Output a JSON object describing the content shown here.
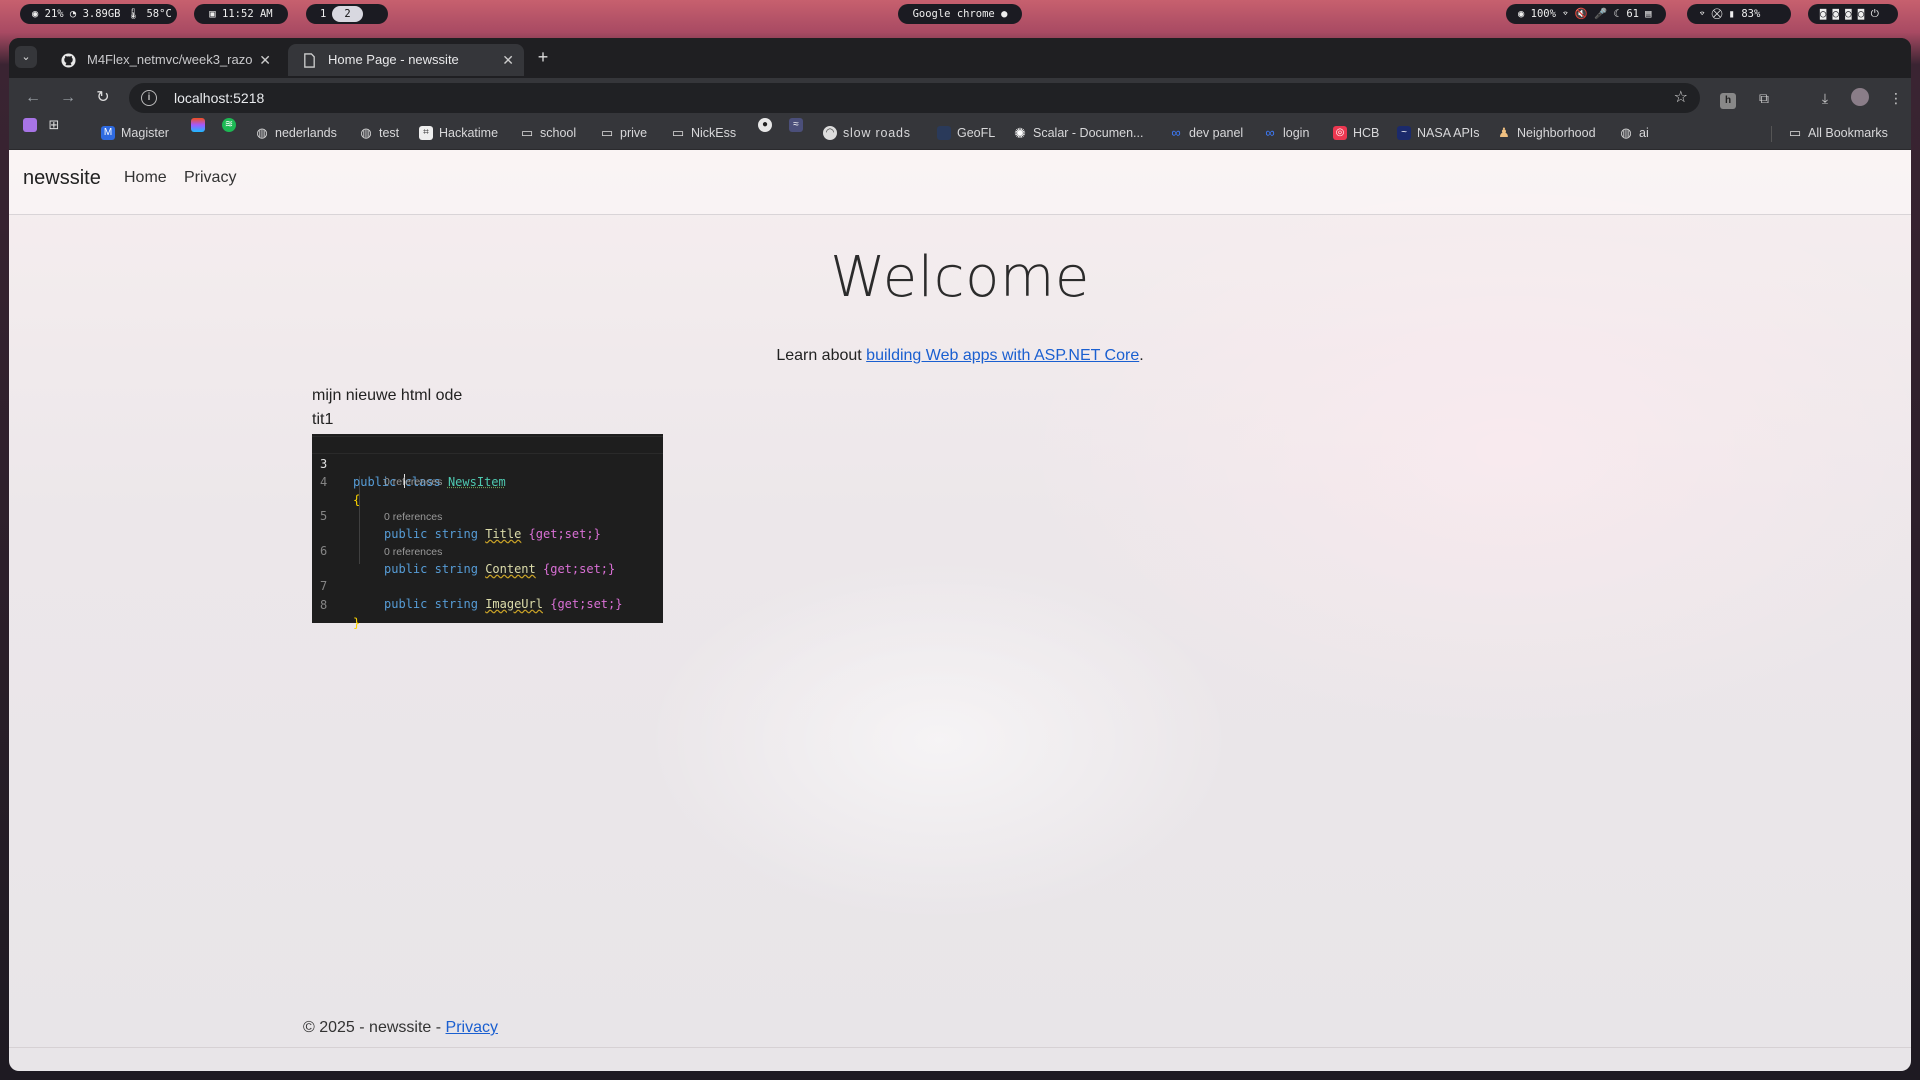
{
  "system_bar": {
    "stats": "◉ 21%  ◔ 3.89GB  🌡 58°C",
    "clock": "11:52 AM",
    "workspaces": [
      "1",
      "2"
    ],
    "active_window": "Google chrome",
    "tray": "◉ 100%  ⌔  🔇  🎤  ☾ 61  ▤",
    "battery": "⌔  ⛒  ▮ 83%",
    "power": "◙ ◙ ◙ ◙ ⏻"
  },
  "browser": {
    "tabs": [
      {
        "title": "M4Flex_netmvc/week3_razo",
        "icon": "github-icon",
        "active": false
      },
      {
        "title": "Home Page - newssite",
        "icon": "page-icon",
        "active": true
      }
    ],
    "url": "localhost:5218",
    "bookmarks": [
      {
        "label": "",
        "icon": "purple-square-icon"
      },
      {
        "label": "",
        "icon": "apps-grid-icon"
      },
      {
        "label": "Magister",
        "icon": "magister-icon"
      },
      {
        "label": "",
        "icon": "figma-icon"
      },
      {
        "label": "",
        "icon": "spotify-icon"
      },
      {
        "label": "nederlands",
        "icon": "globe-icon"
      },
      {
        "label": "test",
        "icon": "globe-icon"
      },
      {
        "label": "Hackatime",
        "icon": "hackatime-icon"
      },
      {
        "label": "school",
        "icon": "folder-icon"
      },
      {
        "label": "prive",
        "icon": "folder-icon"
      },
      {
        "label": "NickEss",
        "icon": "folder-icon"
      },
      {
        "label": "",
        "icon": "github-icon"
      },
      {
        "label": "",
        "icon": "dashboard-icon"
      },
      {
        "label": "slow roads",
        "icon": "slowroads-icon"
      },
      {
        "label": "GeoFL",
        "icon": "geofl-icon"
      },
      {
        "label": "Scalar - Documen...",
        "icon": "scalar-icon"
      },
      {
        "label": "dev panel",
        "icon": "meta-icon"
      },
      {
        "label": "login",
        "icon": "meta-icon"
      },
      {
        "label": "HCB",
        "icon": "hcb-icon"
      },
      {
        "label": "NASA APIs",
        "icon": "nasa-icon"
      },
      {
        "label": "Neighborhood",
        "icon": "neighborhood-icon"
      },
      {
        "label": "ai",
        "icon": "globe-icon"
      }
    ],
    "all_bookmarks": "All Bookmarks"
  },
  "site": {
    "brand": "newssite",
    "nav": [
      "Home",
      "Privacy"
    ],
    "heading": "Welcome",
    "lead_prefix": "Learn about ",
    "lead_link": "building Web apps with ASP.NET Core",
    "lead_suffix": ".",
    "line1": "mijn nieuwe html ode",
    "line2": "tit1",
    "footer_prefix": "© 2025 - newssite - ",
    "footer_link": "Privacy"
  },
  "code_snippet": {
    "lines": [
      {
        "num": "3",
        "kw": "public",
        "kw2": "class",
        "name": "NewsItem"
      },
      {
        "num": "4",
        "text": "{"
      },
      {
        "ref": "0 references"
      },
      {
        "num": "5",
        "kw": "public",
        "type": "string",
        "name": "Title",
        "acc": "{get;set;}"
      },
      {
        "ref": "0 references"
      },
      {
        "num": "6",
        "kw": "public",
        "type": "string",
        "name": "Content",
        "acc": "{get;set;}"
      },
      {
        "ref": "0 references"
      },
      {
        "num": "7",
        "kw": "public",
        "type": "string",
        "name": "ImageUrl",
        "acc": "{get;set;}"
      },
      {
        "num": "8",
        "text": "}"
      }
    ]
  }
}
